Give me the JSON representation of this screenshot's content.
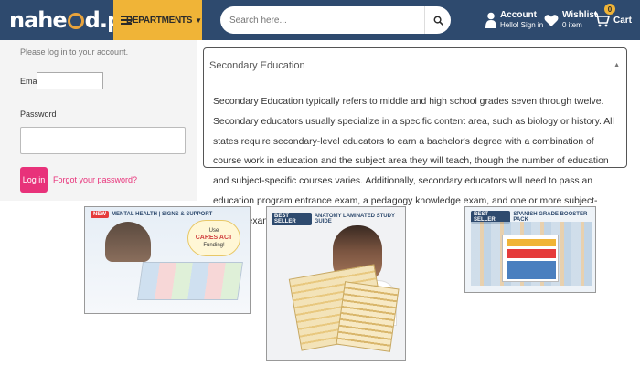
{
  "header": {
    "logo": {
      "part1": "nahe",
      "part2": "d",
      "tld": ".pk"
    },
    "departments_label": "DEPARTMENTS",
    "search_placeholder": "Search here...",
    "account": {
      "title": "Account",
      "subtitle": "Hello! Sign in"
    },
    "wishlist": {
      "title": "Wishlist",
      "subtitle": "0 item"
    },
    "cart": {
      "label": "Cart",
      "count": "0"
    },
    "colors": {
      "bar": "#2e4a6e",
      "accent": "#f0b437"
    }
  },
  "login": {
    "intro": "Please log in to your account.",
    "email_label": "Email",
    "password_label": "Password",
    "login_button": "Log in",
    "forgot_link": "Forgot your password?",
    "button_color": "#e8327a"
  },
  "accordion": {
    "title": "Secondary Education",
    "body": "Secondary Education typically refers to middle and high school grades seven through twelve. Secondary educators usually specialize in a specific content area, such as biology or history. All states require secondary-level educators to earn a bachelor's degree with a combination of course work in education and the subject area they will teach, though the number of education and subject-specific courses varies. Additionally, secondary educators will need to pass an education program entrance exam, a pedagogy knowledge exam, and one or more subject-specific exams to be considered for licensure."
  },
  "products": [
    {
      "badge": "NEW",
      "title": "MENTAL HEALTH | SIGNS & SUPPORT",
      "callout_top": "Use",
      "callout_mid": "CARES ACT",
      "callout_bottom": "Funding!"
    },
    {
      "badge": "BEST SELLER",
      "title": "ANATOMY LAMINATED STUDY GUIDE"
    },
    {
      "badge": "BEST SELLER",
      "title": "SPANISH GRADE BOOSTER PACK"
    }
  ],
  "icons": {
    "search": "search-icon",
    "account": "user-icon",
    "wishlist": "heart-icon",
    "cart": "cart-icon",
    "menu": "menu-icon",
    "accordion_toggle": "chevron-up-icon"
  }
}
